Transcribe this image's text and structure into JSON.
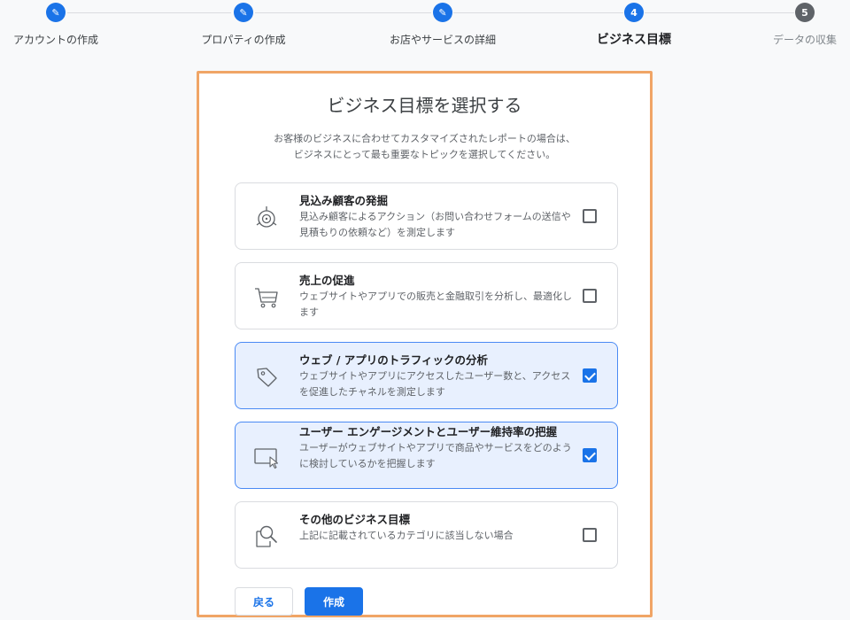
{
  "stepper": {
    "steps": [
      {
        "label": "アカウントの作成",
        "status": "done",
        "marker": "✎"
      },
      {
        "label": "プロパティの作成",
        "status": "done",
        "marker": "✎"
      },
      {
        "label": "お店やサービスの詳細",
        "status": "done",
        "marker": "✎"
      },
      {
        "label": "ビジネス目標",
        "status": "active",
        "marker": "4"
      },
      {
        "label": "データの収集",
        "status": "pending",
        "marker": "5"
      }
    ]
  },
  "card": {
    "title": "ビジネス目標を選択する",
    "subtitle_line1": "お客様のビジネスに合わせてカスタマイズされたレポートの場合は、",
    "subtitle_line2": "ビジネスにとって最も重要なトピックを選択してください。",
    "options": [
      {
        "title": "見込み顧客の発掘",
        "desc": "見込み顧客によるアクション（お問い合わせフォームの送信や見積もりの依頼など）を測定します",
        "checked": false,
        "icon": "target-icon"
      },
      {
        "title": "売上の促進",
        "desc": "ウェブサイトやアプリでの販売と金融取引を分析し、最適化します",
        "checked": false,
        "icon": "cart-icon"
      },
      {
        "title": "ウェブ / アプリのトラフィックの分析",
        "desc": "ウェブサイトやアプリにアクセスしたユーザー数と、アクセスを促進したチャネルを測定します",
        "checked": true,
        "icon": "tag-icon"
      },
      {
        "title": "ユーザー エンゲージメントとユーザー維持率の把握",
        "desc": "ユーザーがウェブサイトやアプリで商品やサービスをどのように検討しているかを把握します",
        "checked": true,
        "icon": "cursor-window-icon"
      },
      {
        "title": "その他のビジネス目標",
        "desc": "上記に記載されているカテゴリに該当しない場合",
        "checked": false,
        "icon": "search-doc-icon"
      }
    ],
    "back_label": "戻る",
    "create_label": "作成"
  },
  "colors": {
    "accent": "#1a73e8",
    "highlight_border": "#f0a566",
    "checked_bg": "#e8f0fe"
  }
}
